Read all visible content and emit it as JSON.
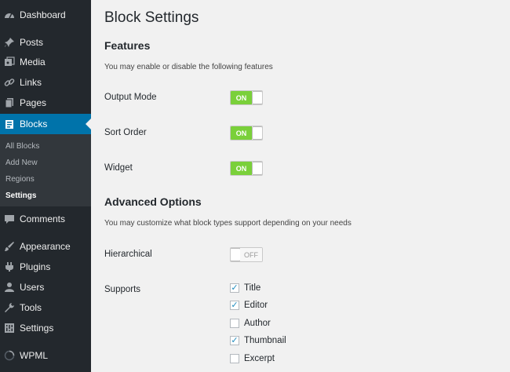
{
  "sidebar": {
    "menu": [
      {
        "label": "Dashboard",
        "icon": "dashboard-icon"
      },
      {
        "label": "Posts",
        "icon": "pushpin-icon"
      },
      {
        "label": "Media",
        "icon": "media-icon"
      },
      {
        "label": "Links",
        "icon": "link-icon"
      },
      {
        "label": "Pages",
        "icon": "pages-icon"
      },
      {
        "label": "Blocks",
        "icon": "blocks-icon",
        "active": true
      },
      {
        "label": "Comments",
        "icon": "comment-icon"
      },
      {
        "label": "Appearance",
        "icon": "paintbrush-icon"
      },
      {
        "label": "Plugins",
        "icon": "plugin-icon"
      },
      {
        "label": "Users",
        "icon": "user-icon"
      },
      {
        "label": "Tools",
        "icon": "wrench-icon"
      },
      {
        "label": "Settings",
        "icon": "settings-icon"
      },
      {
        "label": "WPML",
        "icon": "wpml-icon"
      }
    ],
    "submenu": [
      {
        "label": "All Blocks"
      },
      {
        "label": "Add New"
      },
      {
        "label": "Regions"
      },
      {
        "label": "Settings",
        "current": true
      }
    ]
  },
  "main": {
    "title": "Block Settings",
    "features": {
      "heading": "Features",
      "description": "You may enable or disable the following features",
      "rows": [
        {
          "label": "Output Mode",
          "state": "ON"
        },
        {
          "label": "Sort Order",
          "state": "ON"
        },
        {
          "label": "Widget",
          "state": "ON"
        }
      ]
    },
    "advanced": {
      "heading": "Advanced Options",
      "description": "You may customize what block types support depending on your needs",
      "hierarchical": {
        "label": "Hierarchical",
        "state": "OFF"
      },
      "supports": {
        "label": "Supports",
        "options": [
          {
            "label": "Title",
            "checked": true
          },
          {
            "label": "Editor",
            "checked": true
          },
          {
            "label": "Author",
            "checked": false
          },
          {
            "label": "Thumbnail",
            "checked": true
          },
          {
            "label": "Excerpt",
            "checked": false
          }
        ]
      }
    }
  },
  "colors": {
    "sidebar_bg": "#23282d",
    "active_bg": "#0073aa",
    "toggle_on": "#7ad03a",
    "check": "#1e8cbe"
  }
}
